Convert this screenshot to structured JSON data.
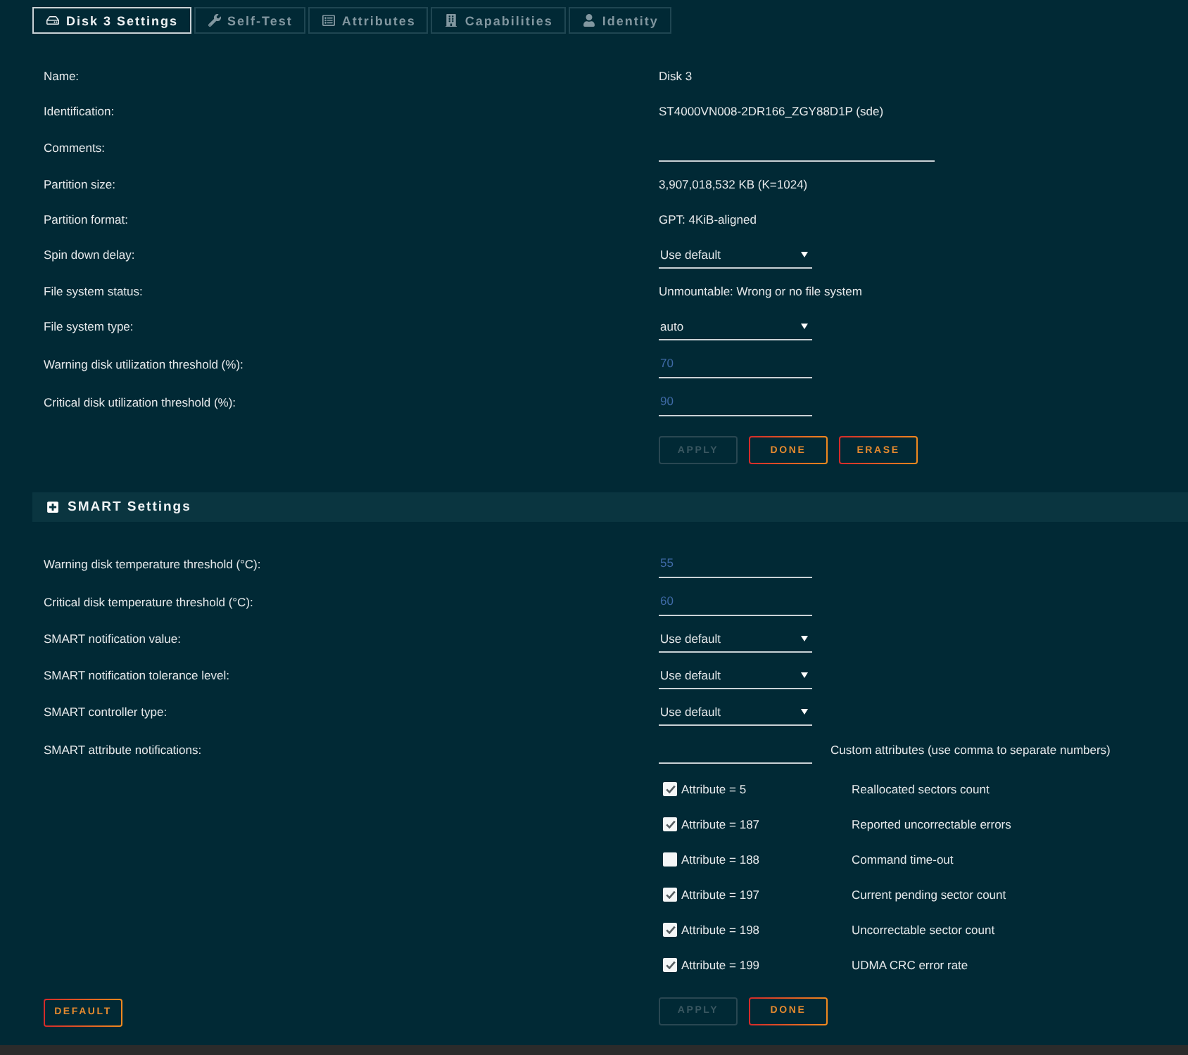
{
  "tabs": [
    {
      "label": "Disk 3 Settings",
      "selected": true
    },
    {
      "label": "Self-Test",
      "selected": false
    },
    {
      "label": "Attributes",
      "selected": false
    },
    {
      "label": "Capabilities",
      "selected": false
    },
    {
      "label": "Identity",
      "selected": false
    }
  ],
  "disk_settings": {
    "rows": [
      {
        "kind": "text",
        "label": "Name:",
        "value": "Disk 3"
      },
      {
        "kind": "text",
        "label": "Identification:",
        "value": "ST4000VN008-2DR166_ZGY88D1P (sde)"
      },
      {
        "kind": "textbox",
        "label": "Comments:"
      },
      {
        "kind": "text",
        "label": "Partition size:",
        "value": "3,907,018,532 KB (K=1024)"
      },
      {
        "kind": "text",
        "label": "Partition format:",
        "value": "GPT: 4KiB-aligned"
      },
      {
        "kind": "select",
        "label": "Spin down delay:",
        "value": "Use default"
      },
      {
        "kind": "text",
        "label": "File system status:",
        "value": "Unmountable: Wrong or no file system"
      },
      {
        "kind": "select",
        "label": "File system type:",
        "value": "auto"
      },
      {
        "kind": "number",
        "label": "Warning disk utilization threshold (%):",
        "placeholder": "70"
      },
      {
        "kind": "number",
        "label": "Critical disk utilization threshold (%):",
        "placeholder": "90"
      }
    ],
    "buttons": [
      {
        "label": "APPLY",
        "disabled": true
      },
      {
        "label": "DONE",
        "disabled": false
      },
      {
        "label": "ERASE",
        "disabled": false
      }
    ]
  },
  "smart_settings": {
    "title": "SMART Settings",
    "rows": [
      {
        "kind": "number",
        "label": "Warning disk temperature threshold (°C):",
        "placeholder": "55"
      },
      {
        "kind": "number",
        "label": "Critical disk temperature threshold (°C):",
        "placeholder": "60"
      },
      {
        "kind": "select",
        "label": "SMART notification value:",
        "value": "Use default"
      },
      {
        "kind": "select",
        "label": "SMART notification tolerance level:",
        "value": "Use default"
      },
      {
        "kind": "select",
        "label": "SMART controller type:",
        "value": "Use default"
      }
    ],
    "attribute_notifications": {
      "label": "SMART attribute notifications:",
      "custom_label": "Custom attributes (use comma to separate numbers)",
      "attributes": [
        {
          "label": "Attribute = 5",
          "description": "Reallocated sectors count",
          "checked": true
        },
        {
          "label": "Attribute = 187",
          "description": "Reported uncorrectable errors",
          "checked": true
        },
        {
          "label": "Attribute = 188",
          "description": "Command time-out",
          "checked": false
        },
        {
          "label": "Attribute = 197",
          "description": "Current pending sector count",
          "checked": true
        },
        {
          "label": "Attribute = 198",
          "description": "Uncorrectable sector count",
          "checked": true
        },
        {
          "label": "Attribute = 199",
          "description": "UDMA CRC error rate",
          "checked": true
        }
      ]
    },
    "default_button": {
      "label": "DEFAULT",
      "disabled": false
    },
    "buttons": [
      {
        "label": "APPLY",
        "disabled": true
      },
      {
        "label": "DONE",
        "disabled": false
      }
    ]
  }
}
